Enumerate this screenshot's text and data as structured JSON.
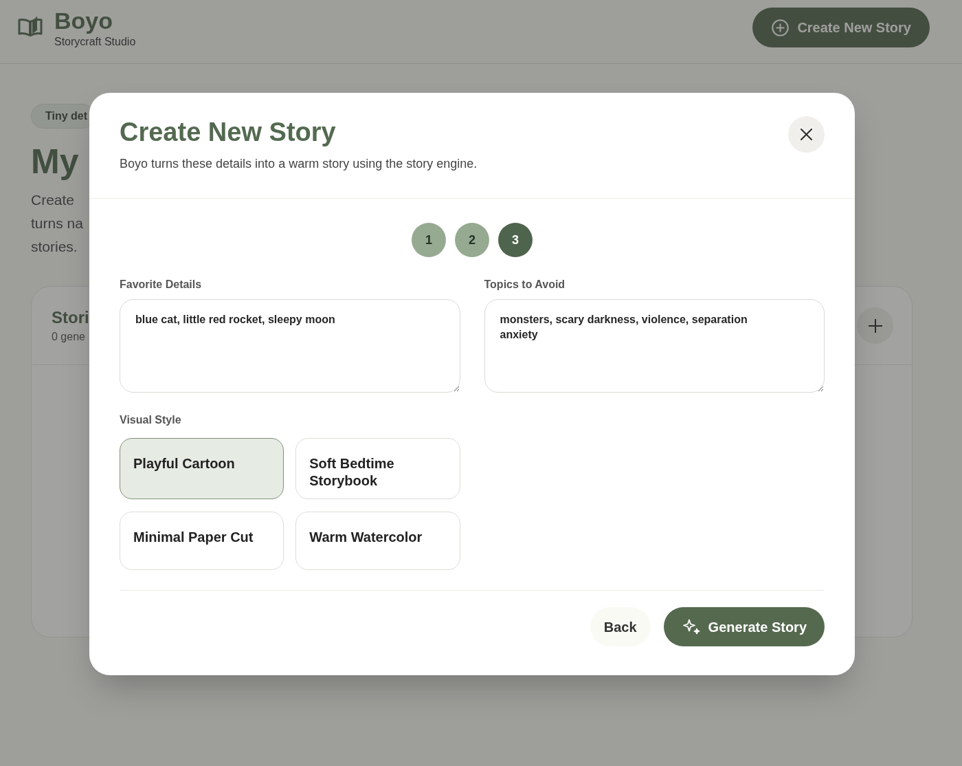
{
  "header": {
    "brand": "Boyo",
    "tagline": "Storycraft Studio",
    "create_button": "Create New Story"
  },
  "page": {
    "badge": "Tiny det",
    "heading": "My",
    "intro_lines": [
      "Create",
      "turns na",
      "stories."
    ],
    "stories_card": {
      "title": "Stori",
      "subtitle": "0 gene"
    }
  },
  "modal": {
    "title": "Create New Story",
    "subtitle": "Boyo turns these details into a warm story using the story engine.",
    "steps": [
      {
        "label": "1",
        "selected": false
      },
      {
        "label": "2",
        "selected": false
      },
      {
        "label": "3",
        "selected": true
      }
    ],
    "fields": [
      {
        "label": "Favorite Details",
        "value": "blue cat, little red rocket, sleepy moon"
      },
      {
        "label": "Topics to Avoid",
        "value": "monsters, scary darkness, violence, separation anxiety"
      }
    ],
    "visual_style": {
      "label": "Visual Style",
      "options": [
        {
          "label": "Playful Cartoon",
          "selected": true
        },
        {
          "label": "Soft Bedtime Storybook",
          "selected": false
        },
        {
          "label": "Minimal Paper Cut",
          "selected": false
        },
        {
          "label": "Warm Watercolor",
          "selected": false
        }
      ]
    },
    "buttons": [
      {
        "label": "Back",
        "kind": "secondary"
      },
      {
        "label": "Generate Story",
        "kind": "primary"
      }
    ]
  }
}
